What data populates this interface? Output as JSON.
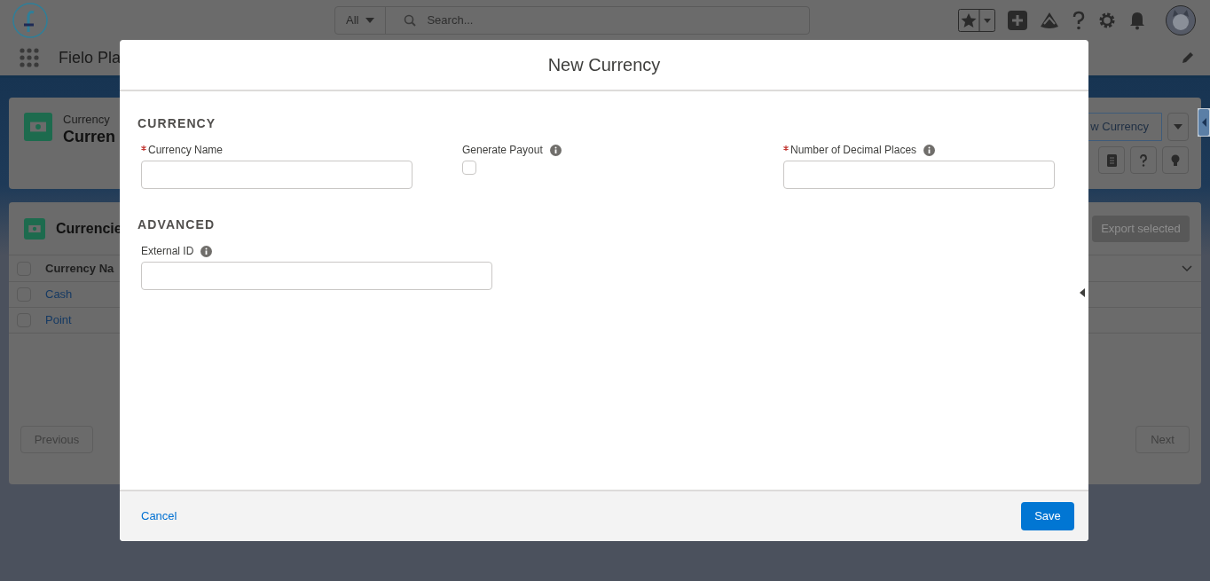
{
  "global_header": {
    "scope": "All",
    "search_placeholder": "Search..."
  },
  "app_nav": {
    "app_name": "Fielo Pla"
  },
  "page_header": {
    "object_label": "Currency",
    "title": "Curren",
    "action": "w Currency"
  },
  "list": {
    "title": "Currencie",
    "export_button": "Export selected",
    "column_1": "Currency Na",
    "select_all_checked": false,
    "rows": [
      {
        "name": "Cash",
        "checked": false
      },
      {
        "name": "Point",
        "checked": false
      }
    ],
    "previous": "Previous",
    "next": "Next"
  },
  "modal": {
    "title": "New Currency",
    "sections": [
      {
        "heading": "CURRENCY",
        "fields": [
          {
            "kind": "text",
            "label": "Currency Name",
            "required": true,
            "info": false
          },
          {
            "kind": "checkbox",
            "label": "Generate Payout",
            "required": false,
            "info": true,
            "checked": false
          },
          {
            "kind": "text",
            "label": "Number of Decimal Places",
            "required": true,
            "info": true
          }
        ]
      },
      {
        "heading": "ADVANCED",
        "fields": [
          {
            "kind": "text",
            "label": "External ID",
            "required": false,
            "info": true
          }
        ]
      }
    ],
    "cancel": "Cancel",
    "save": "Save"
  }
}
